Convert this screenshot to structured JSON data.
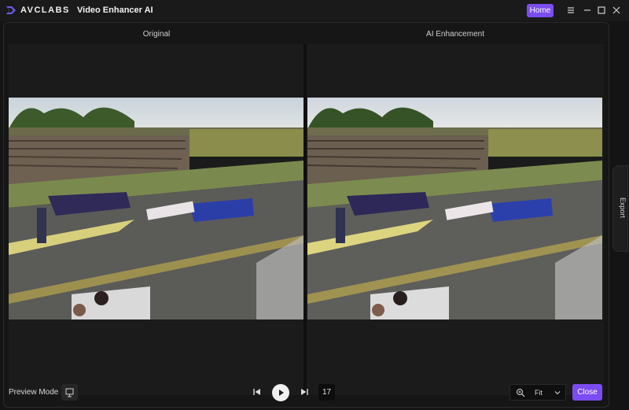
{
  "titlebar": {
    "brand": "AVCLABS",
    "app_title": "Video Enhancer AI",
    "home_label": "Home",
    "menu_icon": "hamburger-icon",
    "minimize_icon": "minimize-icon",
    "maximize_icon": "maximize-icon",
    "close_icon": "close-icon"
  },
  "panes": {
    "left_label": "Original",
    "right_label": "AI Enhancement"
  },
  "side_tab": {
    "label": "Export"
  },
  "bottom": {
    "preview_mode_label": "Preview Mode",
    "frame_number": "17",
    "zoom_value": "Fit",
    "close_label": "Close"
  },
  "colors": {
    "accent": "#7b4cf0",
    "background": "#141414"
  }
}
